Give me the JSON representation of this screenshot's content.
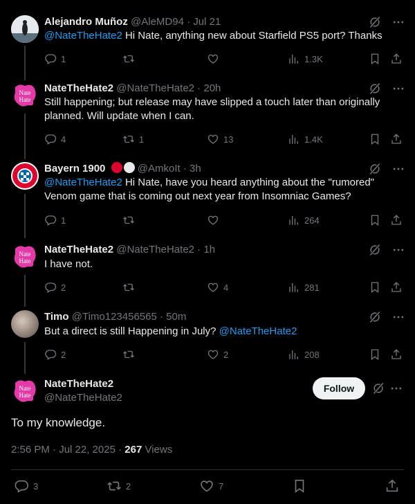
{
  "tweets": [
    {
      "name": "Alejandro Muñoz",
      "handle": "@AleMD94",
      "time": "Jul 21",
      "mention": "@NateTheHate2",
      "text": " Hi Nate, anything new about Starfield PS5 port? Thanks",
      "replies": "1",
      "retweets": "",
      "likes": "",
      "views": "1.3K"
    },
    {
      "name": "NateTheHate2",
      "handle": "@NateTheHate2",
      "time": "20h",
      "text": "Still happening; but release may have slipped a touch later than originally planned. Will update when I can.",
      "replies": "4",
      "retweets": "1",
      "likes": "13",
      "views": "1.4K"
    },
    {
      "name": "Bayern 1900",
      "handle": "@AmkoIt",
      "time": "3h",
      "mention": "@NateTheHate2",
      "text": " Hi Nate, have you heard anything about the \"rumored\" Venom game that is coming out next year from Insomniac Games?",
      "replies": "1",
      "retweets": "",
      "likes": "",
      "views": "264"
    },
    {
      "name": "NateTheHate2",
      "handle": "@NateTheHate2",
      "time": "1h",
      "text": "I have not.",
      "replies": "2",
      "retweets": "",
      "likes": "4",
      "views": "281"
    },
    {
      "name": "Timo",
      "handle": "@Timo123456565",
      "time": "50m",
      "text": "But a direct is still Happening in July? ",
      "mention": "@NateTheHate2",
      "replies": "2",
      "retweets": "",
      "likes": "2",
      "views": "208"
    }
  ],
  "main": {
    "name": "NateTheHate2",
    "handle": "@NateTheHate2",
    "follow": "Follow",
    "text": "To my knowledge.",
    "timestamp": "2:56 PM · Jul 22, 2025 · ",
    "views_count": "267",
    "views_label": " Views",
    "replies": "3",
    "retweets": "2",
    "likes": "7"
  },
  "colors": {
    "accent": "#1d9bf0",
    "muted": "#71767b",
    "bayern_red": "#dc052d"
  },
  "icons": [
    "reply-icon",
    "retweet-icon",
    "like-icon",
    "views-icon",
    "bookmark-icon",
    "share-icon",
    "grok-icon",
    "more-icon"
  ]
}
